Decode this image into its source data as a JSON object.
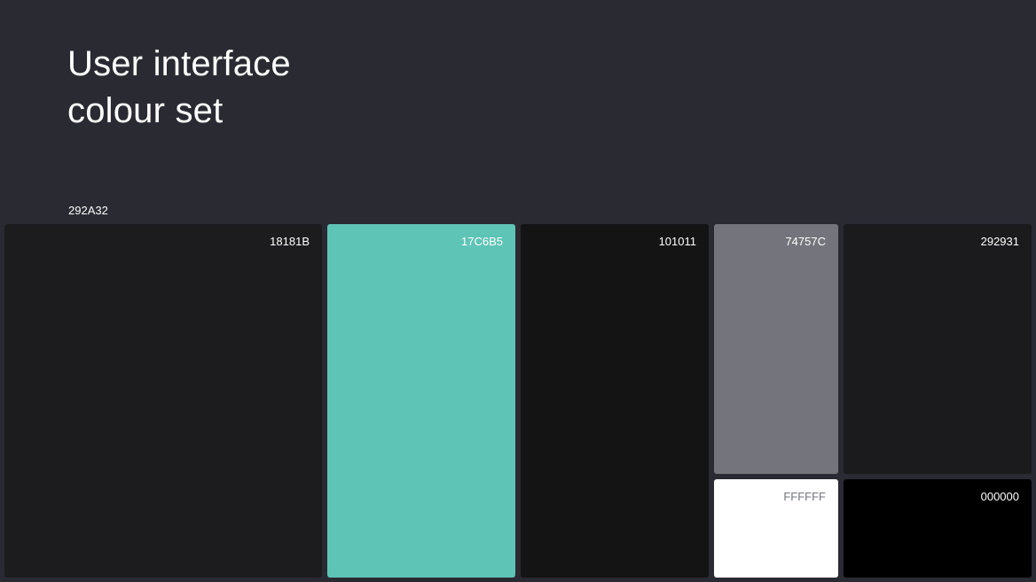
{
  "title": {
    "line1": "User interface",
    "line2": "colour set"
  },
  "background": {
    "code": "292A32",
    "color": "#292A32"
  },
  "swatches": [
    {
      "code": "18181B",
      "color": "#1C1C1F"
    },
    {
      "code": "17C6B5",
      "color": "#5EC4B6"
    },
    {
      "code": "101011",
      "color": "#141415"
    },
    {
      "code": "74757C",
      "color": "#74757C"
    },
    {
      "code": "292931",
      "color": "#1B1B1E"
    },
    {
      "code": "FFFFFF",
      "color": "#FFFFFF"
    },
    {
      "code": "000000",
      "color": "#000000"
    }
  ]
}
